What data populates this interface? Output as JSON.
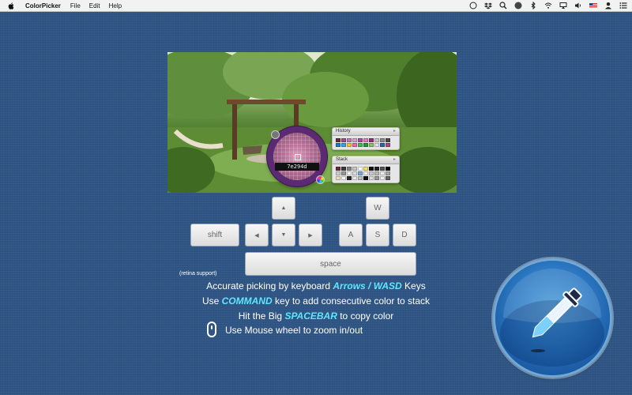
{
  "menubar": {
    "app_name": "ColorPicker",
    "items": [
      "File",
      "Edit",
      "Help"
    ],
    "status_icons": [
      "safari-compass-icon",
      "dropbox-icon",
      "spotlight-search-icon",
      "notification-icon",
      "bluetooth-icon",
      "wifi-icon",
      "airplay-icon",
      "volume-icon",
      "us-flag-icon",
      "user-icon",
      "list-menu-icon"
    ]
  },
  "loupe": {
    "hex": "7e294d"
  },
  "history": {
    "title": "History",
    "colors": [
      "#6b2a3a",
      "#9a4f8a",
      "#c07ab0",
      "#d8a0c6",
      "#b04a98",
      "#e27ab8",
      "#9b2e72",
      "#c6c6c6",
      "#8a8a8a",
      "#4a4a4a",
      "#1a7ac7",
      "#3ba0e0",
      "#f0c23a",
      "#e66aa8",
      "#44b84a",
      "#2f8f3f",
      "#88c060",
      "#e0e0e0",
      "#2a66b0",
      "#a05080"
    ]
  },
  "stack": {
    "title": "Stack",
    "colors": [
      "#6b2a3a",
      "#3a3a3a",
      "#888888",
      "#c8c8c8",
      "#ffffff",
      "#f0e060",
      "#111111",
      "#222222",
      "#555555",
      "#000000",
      "#d0d0d0",
      "#999999",
      "#f6f6f6",
      "#dddddd",
      "#7aa8d8",
      "#f0f0f0",
      "#cccccc",
      "#bbbbbb",
      "#eeeeee",
      "#aaaaaa",
      "#e8e0c0",
      "#f4f4f4",
      "#2a2a2a",
      "#eaeaea",
      "#c0c0c0",
      "#111111",
      "#dcdcdc",
      "#999999",
      "#f0f0f0",
      "#666666"
    ]
  },
  "keys": {
    "up": "▲",
    "left": "◀",
    "down": "▼",
    "right": "▶",
    "shift": "shift",
    "w": "W",
    "a": "A",
    "s": "S",
    "d": "D",
    "space": "space"
  },
  "instructions": {
    "retina": "(retina support)",
    "line1_pre": "Accurate picking by keyboard ",
    "line1_hl": "Arrows / WASD",
    "line1_post": " Keys",
    "line2_pre": "Use ",
    "line2_hl": "COMMAND",
    "line2_post": " key to add consecutive color to stack",
    "line3_pre": "Hit the Big ",
    "line3_hl": "SPACEBAR",
    "line3_post": " to copy color",
    "line4": "Use Mouse wheel to zoom in/out"
  },
  "colors": {
    "background": "#2f5585",
    "highlight": "#5fe6ff",
    "loupe_ring": "#5a2a72"
  },
  "big_button": {
    "icon": "eyedropper-icon"
  }
}
